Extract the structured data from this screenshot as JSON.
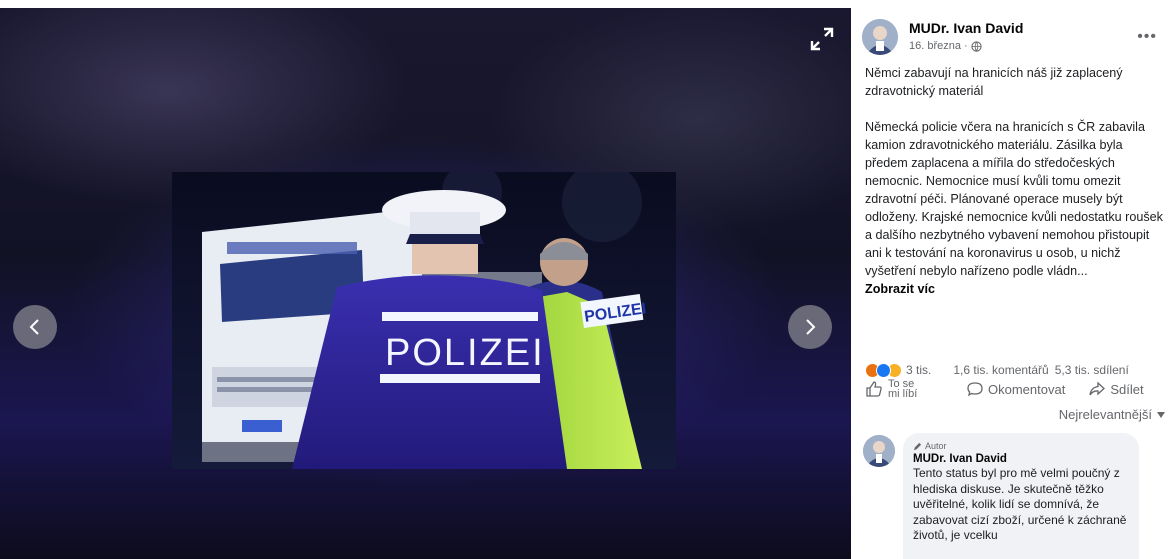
{
  "viewer": {
    "expand_icon": "expand-icon",
    "prev_icon": "chevron-left-icon",
    "next_icon": "chevron-right-icon",
    "photo_sign": "POLIZEI",
    "photo_sign_small": "POLIZEI"
  },
  "post": {
    "author": "MUDr. Ivan David",
    "date": "16. března ·",
    "headline": "Němci zabavují na hranicích náš již zaplacený zdravotnický materiál",
    "body": "Německá policie včera na hranicích s ČR zabavila kamion zdravotnického materiálu. Zásilka byla předem zaplacena a mířila do středočeských nemocnic. Nemocnice musí kvůli tomu omezit zdravotní péči. Plánované operace musely být odloženy. Krajské nemocnice kvůli nedostatku roušek a dalšího nezbytného vybavení nemohou přistoupit ani k testování na koronavirus u osob, u nichž vyšetření nebylo nařízeno podle vládn...",
    "see_more": "Zobrazit víc"
  },
  "stats": {
    "reactions": "3 tis.",
    "comments": "1,6 tis. komentářů",
    "shares": "5,3 tis. sdílení"
  },
  "actions": {
    "like": "To se mi líbí",
    "comment": "Okomentovat",
    "share": "Sdílet"
  },
  "sort": {
    "label": "Nejrelevantnější"
  },
  "comment": {
    "badge": "Autor",
    "author": "MUDr. Ivan David",
    "text": "Tento status byl pro mě velmi poučný z hlediska diskuse. Je skutečně těžko uvěřitelné, kolik lidí se domnívá, že zabavovat cizí zboží, určené k záchraně životů, je vcelku"
  },
  "colors": {
    "accent": "#1877f2",
    "angry": "#e9710f",
    "sad": "#f7b125",
    "meta_text": "#65676b"
  }
}
